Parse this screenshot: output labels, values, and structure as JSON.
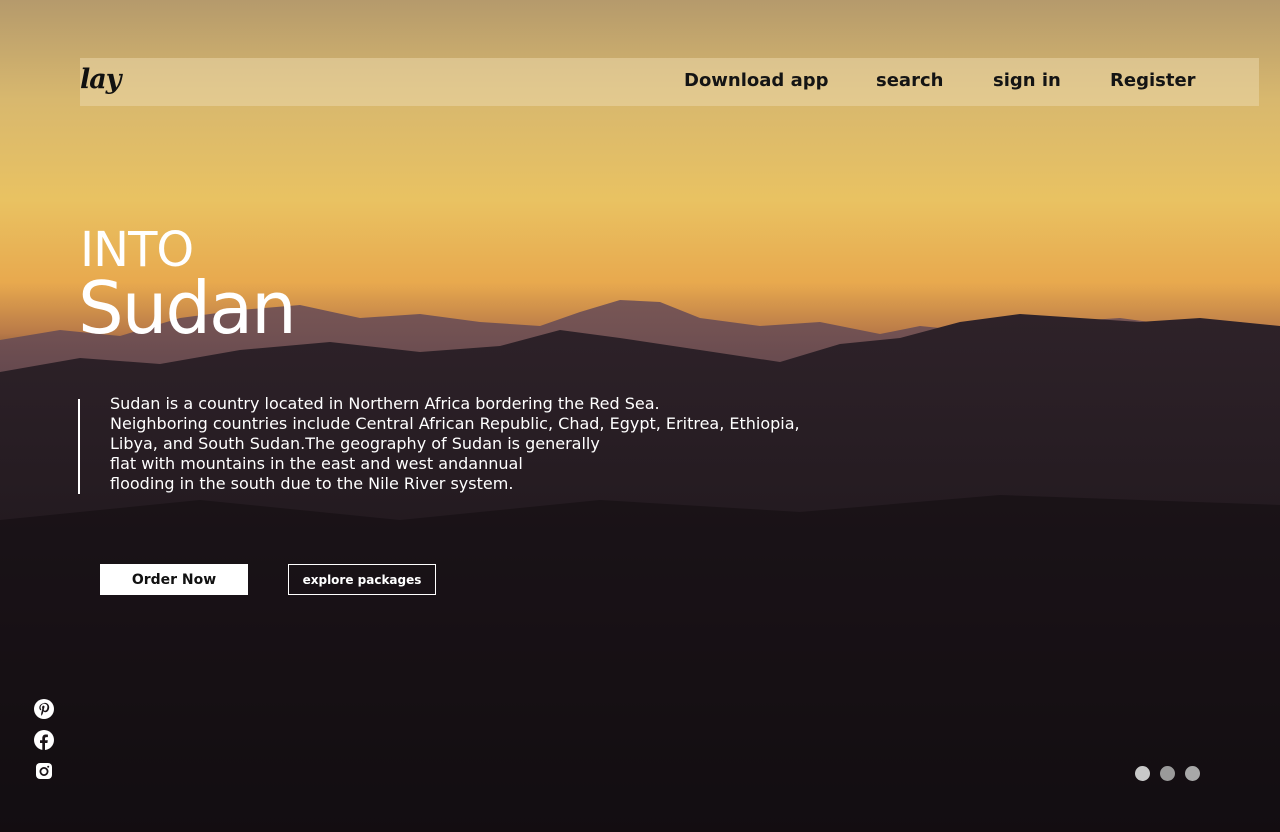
{
  "brand": {
    "logo_text": "lay"
  },
  "nav": {
    "download_label": "Download app",
    "search_label": "search",
    "signin_label": "sign in",
    "register_label": "Register"
  },
  "hero": {
    "pre_title": "INTO",
    "title": "Sudan",
    "description_lines": [
      "Sudan is a country located in Northern Africa bordering the Red Sea.",
      "Neighboring countries include Central African Republic, Chad, Egypt, Eritrea, Ethiopia,",
      "Libya, and South Sudan.The geography of Sudan is generally",
      "flat with mountains in the east and west andannual",
      "flooding in the south due to the Nile River system."
    ]
  },
  "actions": {
    "order_label": "Order Now",
    "explore_label": "explore packages"
  },
  "social": {
    "icons": [
      "pinterest-icon",
      "facebook-icon",
      "instagram-icon"
    ]
  },
  "carousel": {
    "slide_count": 3,
    "active_index": 0
  },
  "colors": {
    "sky_top": "#b59a6c",
    "sky_glow": "#e9c262",
    "navbar_overlay": "#ebd7aa",
    "text_light": "#ffffff",
    "text_dark": "#141414"
  }
}
